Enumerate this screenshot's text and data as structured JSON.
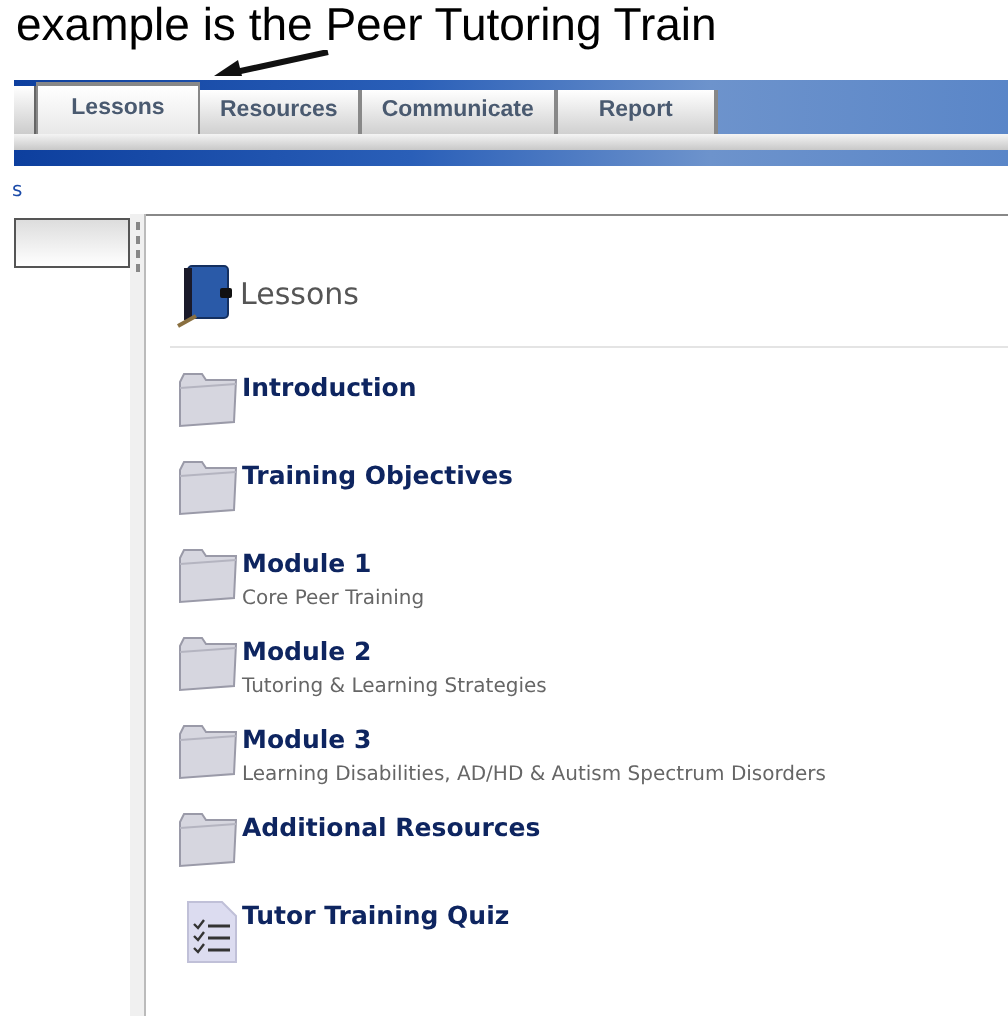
{
  "caption": "example is the Peer Tutoring Train",
  "tabs": [
    {
      "label": "Lessons",
      "selected": true
    },
    {
      "label": "Resources",
      "selected": false
    },
    {
      "label": "Communicate",
      "selected": false
    },
    {
      "label": "Report",
      "selected": false
    }
  ],
  "breadcrumb": "s",
  "heading": "Lessons",
  "items": [
    {
      "kind": "folder",
      "title": "Introduction"
    },
    {
      "kind": "folder",
      "title": "Training Objectives"
    },
    {
      "kind": "folder",
      "title": "Module 1",
      "subtitle": "Core Peer Training"
    },
    {
      "kind": "folder",
      "title": "Module 2",
      "subtitle": "Tutoring & Learning Strategies"
    },
    {
      "kind": "folder",
      "title": "Module 3",
      "subtitle": "Learning Disabilities, AD/HD & Autism Spectrum Disorders"
    },
    {
      "kind": "folder",
      "title": "Additional Resources"
    },
    {
      "kind": "quiz",
      "title": "Tutor Training Quiz"
    }
  ]
}
